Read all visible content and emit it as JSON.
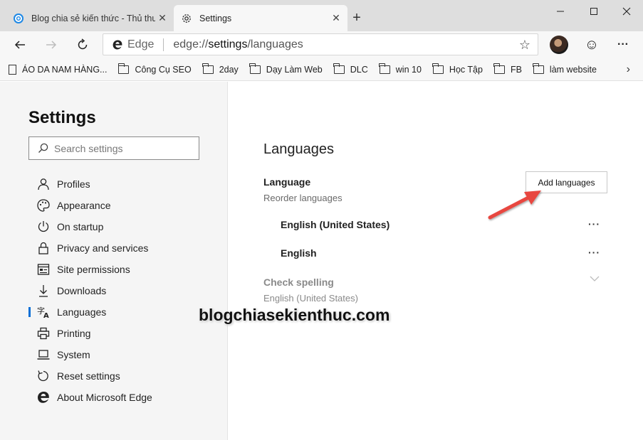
{
  "tabs": [
    {
      "title": "Blog chia sẻ kiến thức - Thủ thuật",
      "close": "✕"
    },
    {
      "title": "Settings",
      "close": "✕"
    }
  ],
  "newtab_label": "+",
  "window": {
    "minimize": "—",
    "maximize": "☐",
    "close": "✕"
  },
  "address": {
    "brand": "Edge",
    "url_prefix": "edge://",
    "url_main": "settings",
    "url_path": "/languages",
    "favorite_icon": "☆"
  },
  "toolbar": {
    "emoji_icon": "☺",
    "more_icon": "···"
  },
  "bookmarks": [
    {
      "label": "ÁO DA NAM HÀNG...",
      "kind": "page"
    },
    {
      "label": "Công Cụ SEO",
      "kind": "folder"
    },
    {
      "label": "2day",
      "kind": "folder"
    },
    {
      "label": "Dạy Làm Web",
      "kind": "folder"
    },
    {
      "label": "DLC",
      "kind": "folder"
    },
    {
      "label": "win 10",
      "kind": "folder"
    },
    {
      "label": "Học Tập",
      "kind": "folder"
    },
    {
      "label": "FB",
      "kind": "folder"
    },
    {
      "label": "làm website",
      "kind": "folder"
    }
  ],
  "bookmarks_more": "›",
  "sidebar": {
    "title": "Settings",
    "search_placeholder": "Search settings",
    "items": [
      {
        "label": "Profiles",
        "icon": "person-icon"
      },
      {
        "label": "Appearance",
        "icon": "palette-icon"
      },
      {
        "label": "On startup",
        "icon": "power-icon"
      },
      {
        "label": "Privacy and services",
        "icon": "lock-icon"
      },
      {
        "label": "Site permissions",
        "icon": "site-permissions-icon"
      },
      {
        "label": "Downloads",
        "icon": "download-icon"
      },
      {
        "label": "Languages",
        "icon": "languages-icon",
        "active": true
      },
      {
        "label": "Printing",
        "icon": "printer-icon"
      },
      {
        "label": "System",
        "icon": "laptop-icon"
      },
      {
        "label": "Reset settings",
        "icon": "reset-icon"
      },
      {
        "label": "About Microsoft Edge",
        "icon": "edge-logo-icon"
      }
    ]
  },
  "main": {
    "heading": "Languages",
    "language_label": "Language",
    "reorder_label": "Reorder languages",
    "add_button": "Add languages",
    "languages": [
      "English (United States)",
      "English"
    ],
    "more_actions": "···",
    "spell_label": "Check spelling",
    "spell_value": "English (United States)"
  },
  "watermark": "blogchiasekienthuc.com",
  "colors": {
    "accent": "#0a6fd6",
    "arrow": "#e8463f"
  }
}
